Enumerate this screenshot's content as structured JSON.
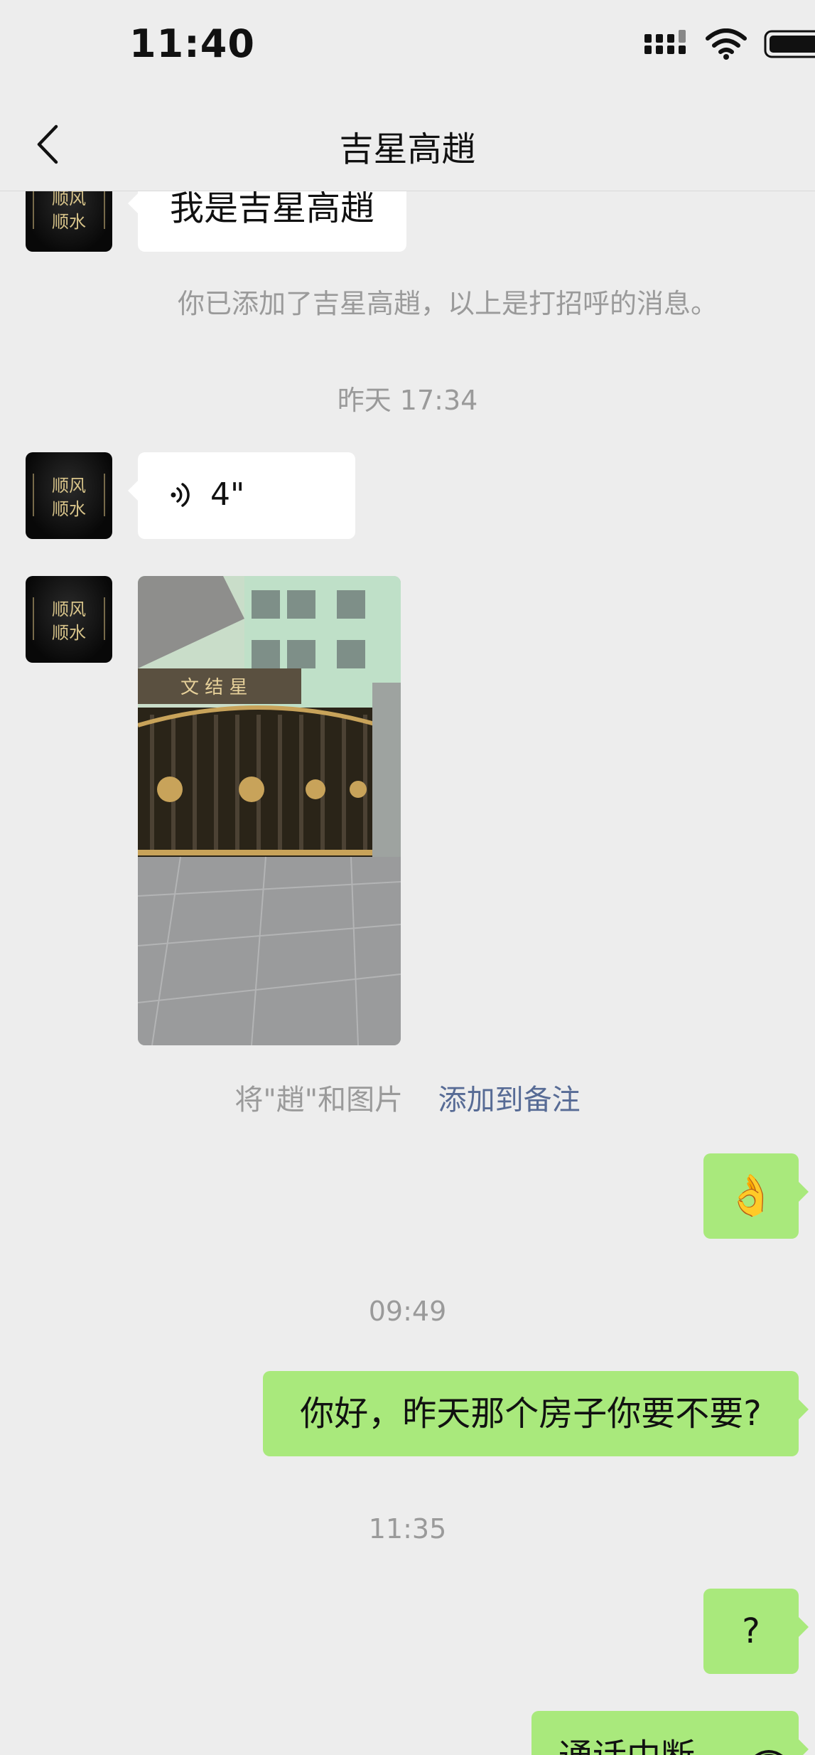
{
  "status_bar": {
    "time": "11:40"
  },
  "nav": {
    "title": "吉星高趙",
    "back_icon": "chevron-left-icon"
  },
  "messages": {
    "greeting_text": "我是吉星高趙",
    "added_notice": "你已添加了吉星高趙，以上是打招呼的消息。",
    "timestamp_1": "昨天 17:34",
    "voice_duration": "4\"",
    "remark_prompt": "将\"趙\"和图片",
    "remark_link": "添加到备注",
    "ok_emoji": "👌",
    "timestamp_2": "09:49",
    "house_question": "你好，昨天那个房子你要不要?",
    "timestamp_3": "11:35",
    "question_mark": "?",
    "call_interrupted": "通话中断"
  },
  "avatar": {
    "text_lines": [
      "顺风",
      "顺水"
    ]
  },
  "colors": {
    "background": "#ededed",
    "bubble_left": "#ffffff",
    "bubble_right": "#a9e97c",
    "link": "#576b95",
    "muted_text": "#9a9a9a"
  }
}
